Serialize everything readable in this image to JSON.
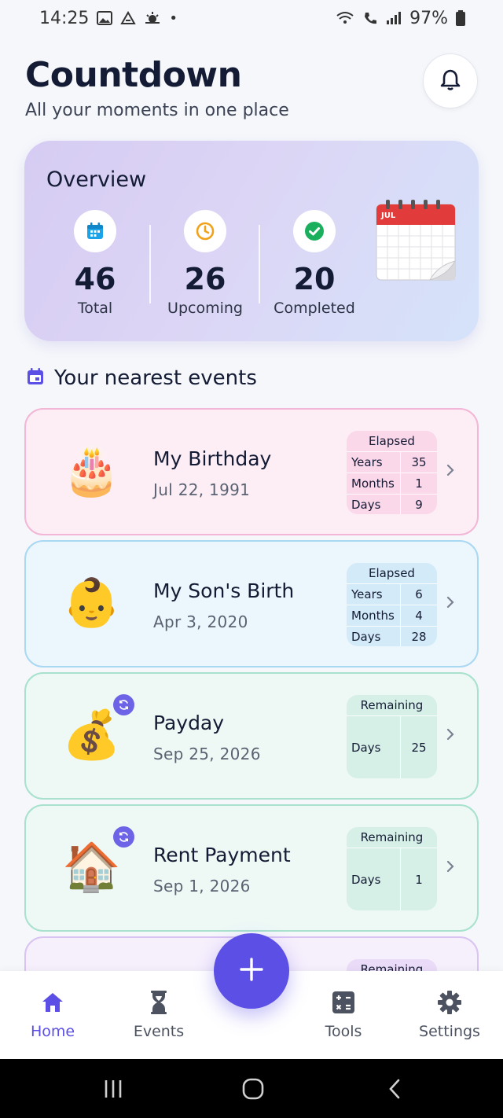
{
  "status_bar": {
    "time": "14:25",
    "battery": "97%"
  },
  "header": {
    "title": "Countdown",
    "subtitle": "All your moments in one place"
  },
  "overview": {
    "title": "Overview",
    "stats": [
      {
        "value": "46",
        "label": "Total",
        "icon": "calendar-icon",
        "color": "#1aa3e8"
      },
      {
        "value": "26",
        "label": "Upcoming",
        "icon": "clock-icon",
        "color": "#f0a21a"
      },
      {
        "value": "20",
        "label": "Completed",
        "icon": "check-circle-icon",
        "color": "#1aaf5d"
      }
    ],
    "calendar_month": "JUL"
  },
  "section": {
    "title": "Your nearest events"
  },
  "events": [
    {
      "name": "My Birthday",
      "date": "Jul 22, 1991",
      "emoji": "🎂",
      "recurring": false,
      "counter": {
        "label": "Elapsed",
        "rows": [
          {
            "k": "Years",
            "v": "35"
          },
          {
            "k": "Months",
            "v": "1"
          },
          {
            "k": "Days",
            "v": "9"
          }
        ]
      }
    },
    {
      "name": "My Son's Birth",
      "date": "Apr 3, 2020",
      "emoji": "👶",
      "recurring": false,
      "counter": {
        "label": "Elapsed",
        "rows": [
          {
            "k": "Years",
            "v": "6"
          },
          {
            "k": "Months",
            "v": "4"
          },
          {
            "k": "Days",
            "v": "28"
          }
        ]
      }
    },
    {
      "name": "Payday",
      "date": "Sep 25, 2026",
      "emoji": "💰",
      "recurring": true,
      "counter": {
        "label": "Remaining",
        "rows": [
          {
            "k": "Days",
            "v": "25"
          }
        ]
      }
    },
    {
      "name": "Rent Payment",
      "date": "Sep 1, 2026",
      "emoji": "🏠",
      "recurring": true,
      "counter": {
        "label": "Remaining",
        "rows": [
          {
            "k": "Days",
            "v": "1"
          }
        ]
      }
    },
    {
      "name": "",
      "date": "",
      "emoji": "",
      "recurring": false,
      "counter": {
        "label": "Remaining",
        "rows": []
      }
    }
  ],
  "colors": {
    "accent": "#5b4fe6",
    "pink": "#fdeef6",
    "blue": "#ecf6fd",
    "green": "#eef9f6",
    "purple": "#f6effc"
  },
  "nav": [
    {
      "label": "Home",
      "icon": "home-icon",
      "active": true
    },
    {
      "label": "Events",
      "icon": "hourglass-icon",
      "active": false
    },
    {
      "label": "Tools",
      "icon": "calculator-icon",
      "active": false
    },
    {
      "label": "Settings",
      "icon": "gear-icon",
      "active": false
    }
  ]
}
